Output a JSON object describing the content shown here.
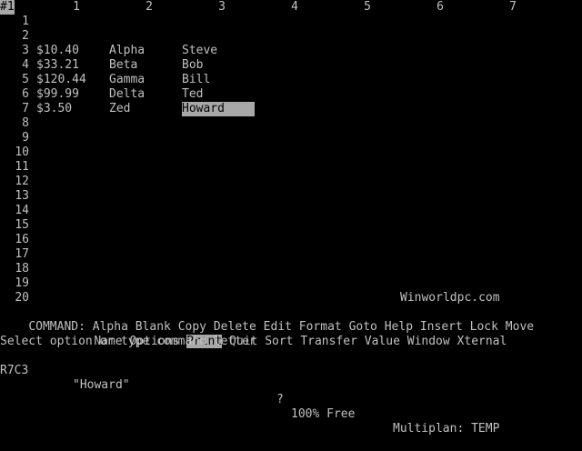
{
  "grid": {
    "corner_label": "#1",
    "columns": [
      "1",
      "2",
      "3",
      "4",
      "5",
      "6",
      "7"
    ],
    "rows": [
      "1",
      "2",
      "3",
      "4",
      "5",
      "6",
      "7",
      "8",
      "9",
      "10",
      "11",
      "12",
      "13",
      "14",
      "15",
      "16",
      "17",
      "18",
      "19",
      "20"
    ],
    "cells": [
      {
        "row": 3,
        "col": 1,
        "text": "$10.40"
      },
      {
        "row": 3,
        "col": 2,
        "text": "Alpha"
      },
      {
        "row": 3,
        "col": 3,
        "text": "Steve"
      },
      {
        "row": 4,
        "col": 1,
        "text": "$33.21"
      },
      {
        "row": 4,
        "col": 2,
        "text": "Beta"
      },
      {
        "row": 4,
        "col": 3,
        "text": "Bob"
      },
      {
        "row": 5,
        "col": 1,
        "text": "$120.44"
      },
      {
        "row": 5,
        "col": 2,
        "text": "Gamma"
      },
      {
        "row": 5,
        "col": 3,
        "text": "Bill"
      },
      {
        "row": 6,
        "col": 1,
        "text": "$99.99"
      },
      {
        "row": 6,
        "col": 2,
        "text": "Delta"
      },
      {
        "row": 6,
        "col": 3,
        "text": "Ted"
      },
      {
        "row": 7,
        "col": 1,
        "text": "$3.50"
      },
      {
        "row": 7,
        "col": 2,
        "text": "Zed"
      },
      {
        "row": 7,
        "col": 3,
        "text": "Howard",
        "selected": true
      }
    ],
    "watermark": "Winworldpc.com"
  },
  "command": {
    "prefix": "COMMAND:",
    "line1": [
      "Alpha",
      "Blank",
      "Copy",
      "Delete",
      "Edit",
      "Format",
      "Goto",
      "Help",
      "Insert",
      "Lock",
      "Move"
    ],
    "line2": [
      "Name",
      "Options",
      "Print",
      "Quit",
      "Sort",
      "Transfer",
      "Value",
      "Window",
      "Xternal"
    ],
    "selected": "Print"
  },
  "prompt": "Select option or type command letter",
  "status": {
    "cell_ref": "R7C3",
    "cell_content": "\"Howard\"",
    "help_hint": "?",
    "free": "100% Free",
    "app": "Multiplan: TEMP"
  },
  "colors": {
    "background": "#000000",
    "text": "#c0c0c0",
    "highlight_bg": "#a8a8a8",
    "highlight_text": "#000000"
  }
}
